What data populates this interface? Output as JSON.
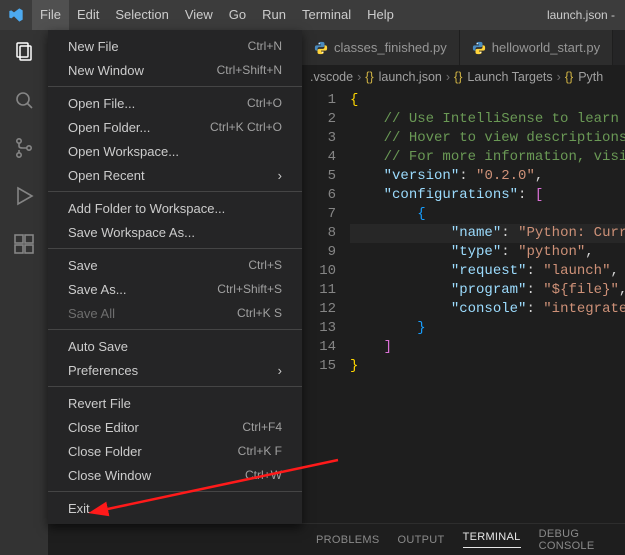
{
  "title": "launch.json -",
  "menubar": [
    "File",
    "Edit",
    "Selection",
    "View",
    "Go",
    "Run",
    "Terminal",
    "Help"
  ],
  "menubar_active_index": 0,
  "file_menu": {
    "groups": [
      [
        {
          "label": "New File",
          "shortcut": "Ctrl+N",
          "disabled": false
        },
        {
          "label": "New Window",
          "shortcut": "Ctrl+Shift+N",
          "disabled": false
        }
      ],
      [
        {
          "label": "Open File...",
          "shortcut": "Ctrl+O",
          "disabled": false
        },
        {
          "label": "Open Folder...",
          "shortcut": "Ctrl+K Ctrl+O",
          "disabled": false
        },
        {
          "label": "Open Workspace...",
          "shortcut": "",
          "disabled": false
        },
        {
          "label": "Open Recent",
          "shortcut": "",
          "submenu": true,
          "disabled": false
        }
      ],
      [
        {
          "label": "Add Folder to Workspace...",
          "shortcut": "",
          "disabled": false
        },
        {
          "label": "Save Workspace As...",
          "shortcut": "",
          "disabled": false
        }
      ],
      [
        {
          "label": "Save",
          "shortcut": "Ctrl+S",
          "disabled": false
        },
        {
          "label": "Save As...",
          "shortcut": "Ctrl+Shift+S",
          "disabled": false
        },
        {
          "label": "Save All",
          "shortcut": "Ctrl+K S",
          "disabled": true
        }
      ],
      [
        {
          "label": "Auto Save",
          "shortcut": "",
          "disabled": false
        },
        {
          "label": "Preferences",
          "shortcut": "",
          "submenu": true,
          "disabled": false
        }
      ],
      [
        {
          "label": "Revert File",
          "shortcut": "",
          "disabled": false
        },
        {
          "label": "Close Editor",
          "shortcut": "Ctrl+F4",
          "disabled": false
        },
        {
          "label": "Close Folder",
          "shortcut": "Ctrl+K F",
          "disabled": false
        },
        {
          "label": "Close Window",
          "shortcut": "Ctrl+W",
          "disabled": false
        }
      ],
      [
        {
          "label": "Exit",
          "shortcut": "",
          "disabled": false
        }
      ]
    ]
  },
  "activity_icons": [
    "explorer-icon",
    "search-icon",
    "source-control-icon",
    "run-debug-icon",
    "extensions-icon"
  ],
  "tabs": [
    {
      "label": "classes_finished.py",
      "icon": "python-icon"
    },
    {
      "label": "helloworld_start.py",
      "icon": "python-icon"
    }
  ],
  "breadcrumbs": [
    ".vscode",
    "launch.json",
    "Launch Targets",
    "Pyth"
  ],
  "code": {
    "lines": [
      {
        "n": 1,
        "html": "<span class='tok-brace'>{</span>"
      },
      {
        "n": 2,
        "html": "    <span class='tok-comment'>// Use IntelliSense to learn </span>"
      },
      {
        "n": 3,
        "html": "    <span class='tok-comment'>// Hover to view descriptions</span>"
      },
      {
        "n": 4,
        "html": "    <span class='tok-comment'>// For more information, visi</span>"
      },
      {
        "n": 5,
        "html": "    <span class='tok-key'>\"version\"</span><span class='tok-punc'>:</span> <span class='tok-string'>\"0.2.0\"</span><span class='tok-punc'>,</span>"
      },
      {
        "n": 6,
        "html": "    <span class='tok-key'>\"configurations\"</span><span class='tok-punc'>:</span> <span class='tok-bracket2'>[</span>"
      },
      {
        "n": 7,
        "html": "        <span class='tok-brace3'>{</span>"
      },
      {
        "n": 8,
        "hl": true,
        "html": "            <span class='tok-key'>\"name\"</span><span class='tok-punc'>:</span> <span class='tok-string'>\"Python: Curr</span>"
      },
      {
        "n": 9,
        "html": "            <span class='tok-key'>\"type\"</span><span class='tok-punc'>:</span> <span class='tok-string'>\"python\"</span><span class='tok-punc'>,</span>"
      },
      {
        "n": 10,
        "html": "            <span class='tok-key'>\"request\"</span><span class='tok-punc'>:</span> <span class='tok-string'>\"launch\"</span><span class='tok-punc'>,</span>"
      },
      {
        "n": 11,
        "html": "            <span class='tok-key'>\"program\"</span><span class='tok-punc'>:</span> <span class='tok-string'>\"${file}\"</span><span class='tok-punc'>,</span>"
      },
      {
        "n": 12,
        "html": "            <span class='tok-key'>\"console\"</span><span class='tok-punc'>:</span> <span class='tok-string'>\"integrate</span>"
      },
      {
        "n": 13,
        "html": "        <span class='tok-brace3'>}</span>"
      },
      {
        "n": 14,
        "html": "    <span class='tok-bracket2'>]</span>"
      },
      {
        "n": 15,
        "html": "<span class='tok-brace'>}</span>"
      }
    ]
  },
  "panel_tabs": [
    "PROBLEMS",
    "OUTPUT",
    "TERMINAL",
    "DEBUG CONSOLE"
  ],
  "panel_active_index": 2
}
